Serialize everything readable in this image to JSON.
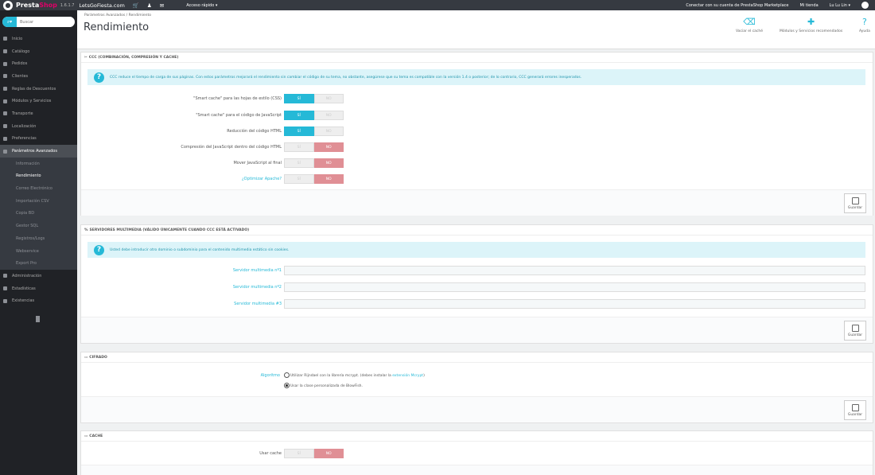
{
  "topbar": {
    "brand_a": "Presta",
    "brand_b": "Shop",
    "version": "1.6.1.7",
    "shop_name": "LetsGoFiesta.com",
    "quick_access": "Acceso rápido ▾",
    "marketplace": "Conectar con su cuenta de PrestaShop Marketplace",
    "my_shop": "Mi tienda",
    "user": "Lu Lu Lin ▾"
  },
  "sidebar": {
    "search_placeholder": "Buscar",
    "items": [
      {
        "label": "Inicio"
      },
      {
        "label": "Catálogo"
      },
      {
        "label": "Pedidos"
      },
      {
        "label": "Clientes"
      },
      {
        "label": "Reglas de Descuentos"
      },
      {
        "label": "Módulos y Servicios"
      },
      {
        "label": "Transporte"
      },
      {
        "label": "Localización"
      },
      {
        "label": "Preferencias"
      },
      {
        "label": "Parámetros Avanzados"
      }
    ],
    "sub_items": [
      {
        "label": "Información"
      },
      {
        "label": "Rendimiento"
      },
      {
        "label": "Correo Electrónico"
      },
      {
        "label": "Importación CSV"
      },
      {
        "label": "Copia BD"
      },
      {
        "label": "Gestor SQL"
      },
      {
        "label": "Registros/Logs"
      },
      {
        "label": "Webservice"
      },
      {
        "label": "Export Pro"
      }
    ],
    "bottom_items": [
      {
        "label": "Administración"
      },
      {
        "label": "Estadísticas"
      },
      {
        "label": "Existencias"
      }
    ]
  },
  "header": {
    "breadcrumb": "Parámetros Avanzados  /  Rendimiento",
    "title": "Rendimiento",
    "btn_clear_cache": "Vaciar el caché",
    "btn_modules": "Módulos y Servicios recomendados",
    "btn_help": "Ayuda"
  },
  "ccc": {
    "heading": "CCC (COMBINACIÓN, COMPRESIÓN Y CACHE)",
    "info": "CCC reduce el tiempo de carga de sus páginas. Con estos parámetros mejorará el rendimiento sin cambiar el código de su tema, no obstante, asegúrese que su tema es compatible con la versión 1.4 o posterior; de lo contrario, CCC generará errores inesperados.",
    "yes": "SÍ",
    "no": "NO",
    "rows": [
      {
        "label": "\"Smart cache\" para las hojas de estilo (CSS)",
        "value": true
      },
      {
        "label": "\"Smart cache\" para el código de JavaScript",
        "value": true
      },
      {
        "label": "Reducción del código HTML",
        "value": true
      },
      {
        "label": "Compresión del JavaScript dentro del código HTML",
        "value": false
      },
      {
        "label": "Mover JavaScript al final",
        "value": false
      },
      {
        "label": "¿Optimizar Apache?",
        "value": false
      }
    ]
  },
  "media": {
    "heading": "SERVIDORES MULTIMEDIA (VÁLIDO ÚNICAMENTE CUANDO CCC ESTÁ ACTIVADO)",
    "info": "Usted debe introducir otro dominio o subdominio para el contenido multimedia estático sin cookies.",
    "server1": "Servidor multimedia nº1",
    "server2": "Servidor multimedia nº2",
    "server3": "Servidor multimedia #3",
    "value1": "",
    "value2": "",
    "value3": ""
  },
  "cipher": {
    "heading": "CIFRADO",
    "label": "Algoritmo",
    "opt1_a": "Utilizar Rijndael con la librería mcrypt. (debes instalar la ",
    "opt1_link": "extensión Mcrypt",
    "opt1_b": ")",
    "opt2": "Usar la clase personalizada de BlowFish.",
    "selected": "BlowFish"
  },
  "cache": {
    "heading": "CACHE",
    "label": "Usar cache",
    "value": false
  },
  "save_label": "Guardar",
  "colors": {
    "accent": "#25b9d7",
    "danger": "#e08f95",
    "brand": "#df0067"
  }
}
